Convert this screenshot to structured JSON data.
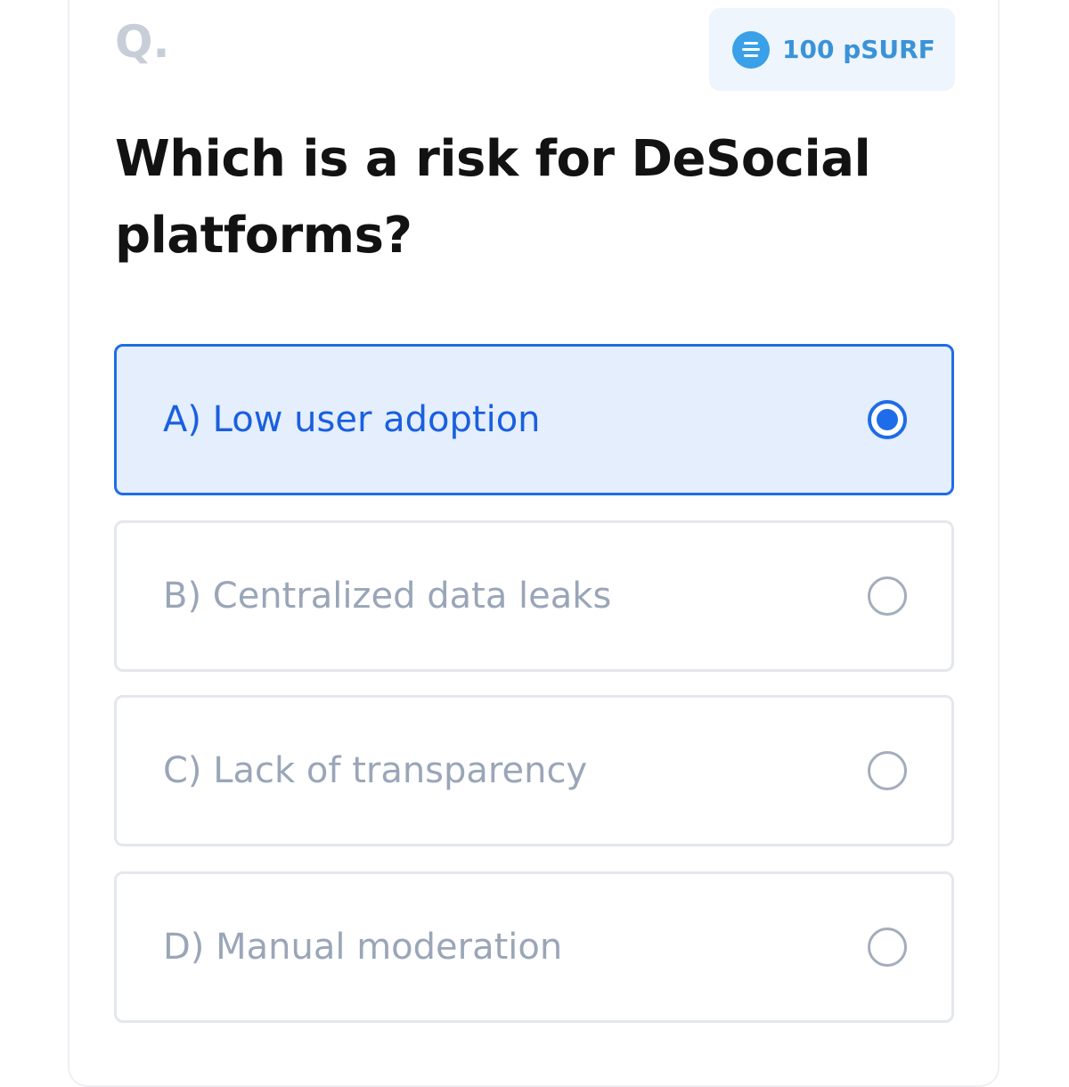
{
  "header": {
    "question_mark": "Q.",
    "reward": {
      "icon": "coin-icon",
      "amount": "100 pSURF"
    }
  },
  "question": "Which is a risk for DeSocial platforms?",
  "options": [
    {
      "label": "A) Low user adoption",
      "selected": true
    },
    {
      "label": "B) Centralized data leaks",
      "selected": false
    },
    {
      "label": "C) Lack of transparency",
      "selected": false
    },
    {
      "label": "D) Manual moderation",
      "selected": false
    }
  ],
  "colors": {
    "accent": "#1f6ce8",
    "selected_background": "#e4eefc",
    "reward_text": "#3a93d8",
    "muted_text": "#9aa6b8"
  }
}
